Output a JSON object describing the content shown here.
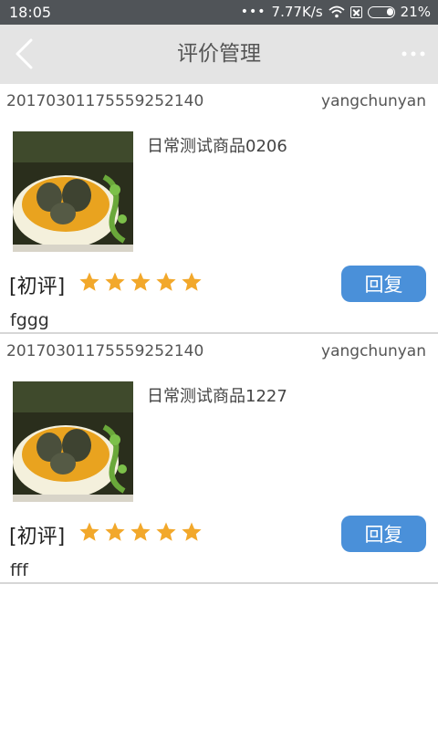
{
  "status_bar": {
    "time": "18:05",
    "net_speed": "7.77K/s",
    "battery": "21%"
  },
  "header": {
    "title": "评价管理"
  },
  "reviews": [
    {
      "order_no": "20170301175559252140",
      "user": "yangchunyan",
      "product_name": "日常测试商品0206",
      "tag": "[初评]",
      "stars": 5,
      "reply_label": "回复",
      "comment": "fggg"
    },
    {
      "order_no": "20170301175559252140",
      "user": "yangchunyan",
      "product_name": "日常测试商品1227",
      "tag": "[初评]",
      "stars": 5,
      "reply_label": "回复",
      "comment": "fff"
    }
  ],
  "colors": {
    "star": "#f2a82b",
    "reply_button": "#4a90d9",
    "nav_bg": "#e4e4e4",
    "status_bg": "#505458"
  }
}
